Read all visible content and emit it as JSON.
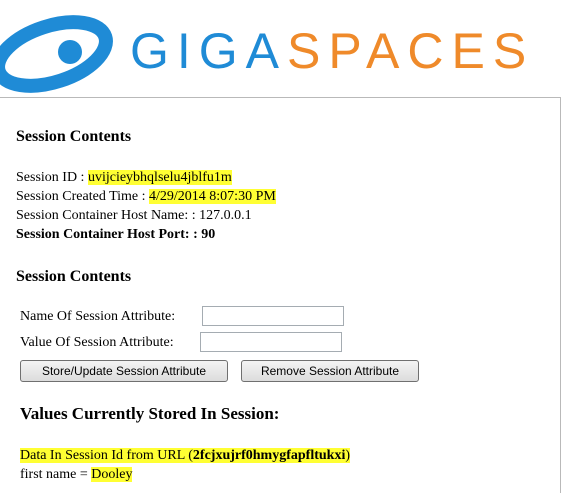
{
  "logo": {
    "text_giga": "GIGA",
    "text_spaces": "SPACES",
    "color_blue": "#1f8bd6",
    "color_orange": "#ef8a2a"
  },
  "section1": {
    "heading": "Session Contents",
    "session_id_label": "Session ID : ",
    "session_id_value": "uvijcieybhqlselu4jblfu1m",
    "created_label": "Session Created Time : ",
    "created_value": "4/29/2014 8:07:30 PM",
    "host_name": "Session Container Host Name: : 127.0.0.1",
    "host_port": "Session Container Host Port: : 90"
  },
  "section2": {
    "heading": "Session Contents",
    "name_label": "Name Of Session Attribute:",
    "name_value": "",
    "value_label": "Value Of Session Attribute:",
    "value_value": "",
    "store_button": "Store/Update Session Attribute",
    "remove_button": "Remove Session Attribute"
  },
  "section3": {
    "heading": "Values Currently Stored In Session:",
    "url_prefix": "Data In Session Id from URL (",
    "url_id": "2fcjxujrf0hmygfapfltukxi",
    "url_suffix": ")",
    "first_name_label": "first name = ",
    "first_name_value": "Dooley"
  },
  "highlight_color": "#ffff33"
}
